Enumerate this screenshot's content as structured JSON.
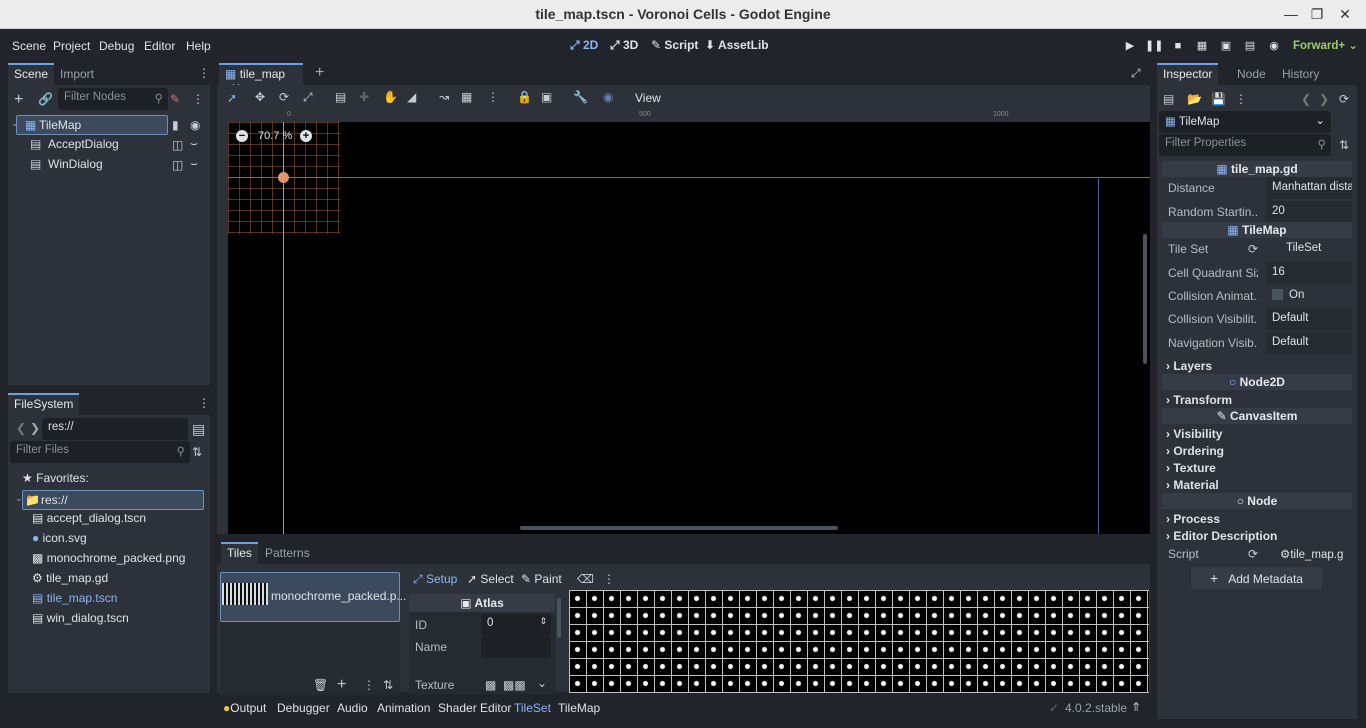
{
  "window": {
    "title": "tile_map.tscn - Voronoi Cells - Godot Engine"
  },
  "menu": {
    "items": [
      "Scene",
      "Project",
      "Debug",
      "Editor",
      "Help"
    ]
  },
  "workspaces": {
    "w2d": "2D",
    "w3d": "3D",
    "script": "Script",
    "assetlib": "AssetLib"
  },
  "renderer": "Forward+",
  "scene_dock": {
    "tabs": [
      "Scene",
      "Import"
    ],
    "filter_placeholder": "Filter Nodes",
    "nodes": [
      "TileMap",
      "AcceptDialog",
      "WinDialog"
    ]
  },
  "filesystem_dock": {
    "tab": "FileSystem",
    "path": "res://",
    "filter_placeholder": "Filter Files",
    "favorites": "Favorites:",
    "root": "res://",
    "files": [
      "accept_dialog.tscn",
      "icon.svg",
      "monochrome_packed.png",
      "tile_map.gd",
      "tile_map.tscn",
      "win_dialog.tscn"
    ]
  },
  "editor": {
    "scene_tab": "tile_map",
    "zoom": "70.7 %",
    "ruler_labels": [
      "0",
      "500",
      "1000"
    ],
    "view_menu": "View"
  },
  "bottom_panel": {
    "tabs": [
      "Tiles",
      "Patterns"
    ],
    "source_name": "monochrome_packed.p...",
    "modes": [
      "Setup",
      "Select",
      "Paint"
    ],
    "atlas_title": "Atlas",
    "id_label": "ID",
    "id_value": "0",
    "name_label": "Name",
    "texture_label": "Texture",
    "dock_tabs": [
      "Output",
      "Debugger",
      "Audio",
      "Animation",
      "Shader Editor",
      "TileSet",
      "TileMap"
    ],
    "version": "4.0.2.stable"
  },
  "inspector": {
    "tabs": [
      "Inspector",
      "Node",
      "History"
    ],
    "object": "TileMap",
    "filter_placeholder": "Filter Properties",
    "script_header": "tile_map.gd",
    "props_script": [
      {
        "label": "Distance",
        "value": "Manhattan distan"
      },
      {
        "label": "Random Startin...",
        "value": "20"
      }
    ],
    "tilemap_header": "TileMap",
    "props_tilemap": [
      {
        "label": "Tile Set",
        "value": "TileSet"
      },
      {
        "label": "Cell Quadrant Size",
        "value": "16"
      },
      {
        "label": "Collision Animat...",
        "value": "On"
      },
      {
        "label": "Collision Visibilit...",
        "value": "Default"
      },
      {
        "label": "Navigation Visib...",
        "value": "Default"
      }
    ],
    "layers": "Layers",
    "node2d_header": "Node2D",
    "transform": "Transform",
    "canvasitem_header": "CanvasItem",
    "canvas_groups": [
      "Visibility",
      "Ordering",
      "Texture",
      "Material"
    ],
    "node_header": "Node",
    "node_groups": [
      "Process",
      "Editor Description"
    ],
    "script_label": "Script",
    "script_value": "tile_map.g",
    "add_metadata": "Add Metadata"
  }
}
